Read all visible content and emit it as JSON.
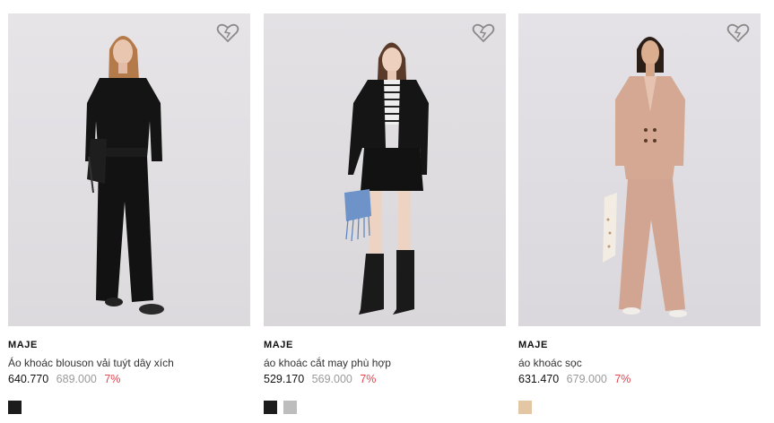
{
  "products": [
    {
      "brand": "MAJE",
      "name": "Áo khoác blouson vải tuýt dây xích",
      "price": "640.770",
      "old_price": "689.000",
      "discount": "7%",
      "swatches": [
        "#1c1c1c"
      ],
      "favorite_icon": "heart-outline-icon"
    },
    {
      "brand": "MAJE",
      "name": "áo khoác cắt may phù hợp",
      "price": "529.170",
      "old_price": "569.000",
      "discount": "7%",
      "swatches": [
        "#1c1c1c",
        "#bdbdbd"
      ],
      "favorite_icon": "heart-outline-icon"
    },
    {
      "brand": "MAJE",
      "name": "áo khoác sọc",
      "price": "631.470",
      "old_price": "679.000",
      "discount": "7%",
      "swatches": [
        "#e3c7a4"
      ],
      "favorite_icon": "heart-outline-icon"
    }
  ],
  "colors": {
    "discount": "#e0464f",
    "old_price": "#9a9a9a",
    "photo_background": "#e2e0e3"
  }
}
